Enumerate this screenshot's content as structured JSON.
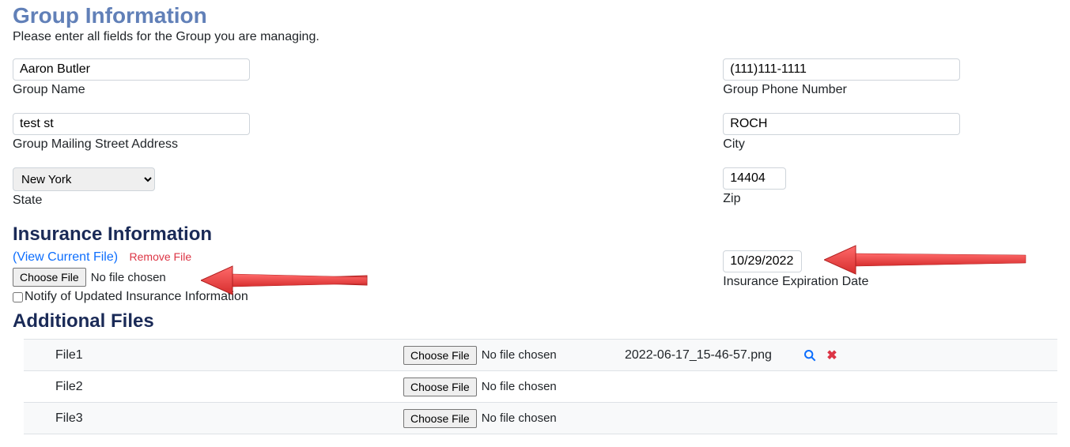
{
  "header": {
    "title": "Group Information",
    "subtitle": "Please enter all fields for the Group you are managing."
  },
  "group": {
    "name": {
      "value": "Aaron Butler",
      "label": "Group Name"
    },
    "phone": {
      "value": "(111)111-1111",
      "label": "Group Phone Number"
    },
    "street": {
      "value": "test st",
      "label": "Group Mailing Street Address"
    },
    "city": {
      "value": "ROCH",
      "label": "City"
    },
    "state": {
      "value": "New York",
      "label": "State"
    },
    "zip": {
      "value": "14404",
      "label": "Zip"
    }
  },
  "insurance": {
    "section_title": "Insurance Information",
    "view_link": "(View Current File)",
    "remove_link": "Remove File",
    "choose_label": "Choose File",
    "choose_status": "No file chosen",
    "notify_label": "Notify of Updated Insurance Information",
    "expiration": {
      "value": "10/29/2022",
      "label": "Insurance Expiration Date"
    }
  },
  "additional": {
    "section_title": "Additional Files",
    "choose_label": "Choose File",
    "choose_status": "No file chosen",
    "rows": [
      {
        "label": "File1",
        "filename": "2022-06-17_15-46-57.png",
        "has_file": true
      },
      {
        "label": "File2",
        "filename": "",
        "has_file": false
      },
      {
        "label": "File3",
        "filename": "",
        "has_file": false
      }
    ]
  }
}
